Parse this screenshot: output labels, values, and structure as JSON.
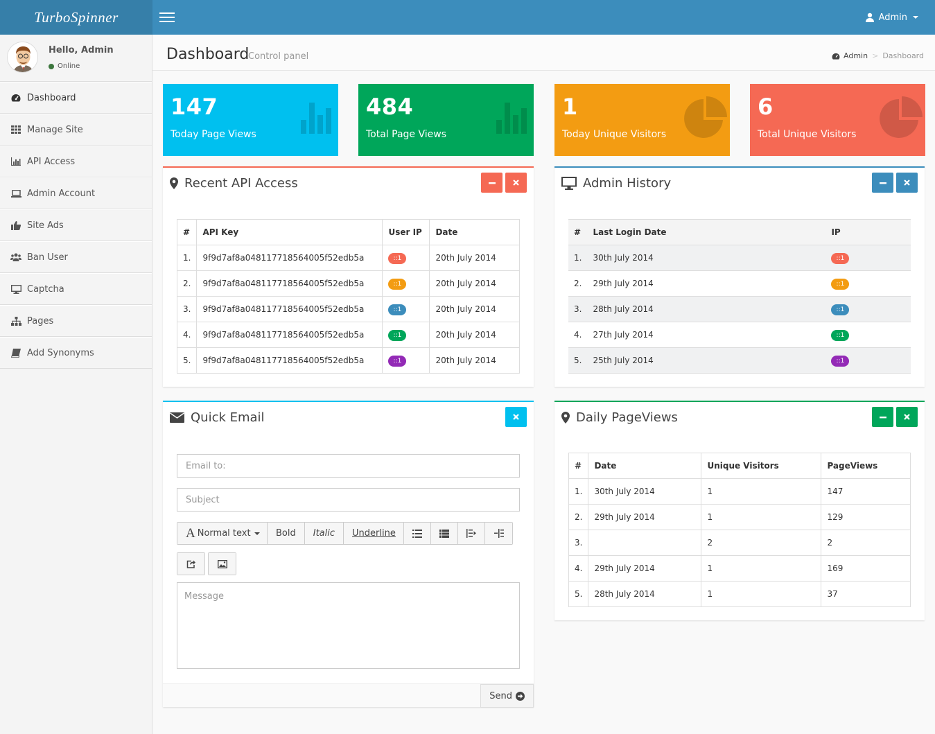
{
  "app": {
    "logo": "TurboSpinner"
  },
  "header": {
    "user_label": "Admin"
  },
  "sidebar": {
    "greeting": "Hello, Admin",
    "status": "Online",
    "items": [
      {
        "label": "Dashboard",
        "icon": "dashboard-icon"
      },
      {
        "label": "Manage Site",
        "icon": "grid-icon"
      },
      {
        "label": "API Access",
        "icon": "bar-chart-icon"
      },
      {
        "label": "Admin Account",
        "icon": "laptop-icon"
      },
      {
        "label": "Site Ads",
        "icon": "thumbs-up-icon"
      },
      {
        "label": "Ban User",
        "icon": "users-icon"
      },
      {
        "label": "Captcha",
        "icon": "desktop-icon"
      },
      {
        "label": "Pages",
        "icon": "sitemap-icon"
      },
      {
        "label": "Add Synonyms",
        "icon": "book-icon"
      }
    ]
  },
  "page": {
    "title": "Dashboard",
    "subtitle": "Control panel"
  },
  "breadcrumb": {
    "home": "Admin",
    "current": "Dashboard"
  },
  "stats": [
    {
      "value": "147",
      "label": "Today Page Views",
      "color": "#00c0ef",
      "icon": "bar-chart-icon"
    },
    {
      "value": "484",
      "label": "Total Page Views",
      "color": "#00a65a",
      "icon": "bar-chart-icon"
    },
    {
      "value": "1",
      "label": "Today Unique Visitors",
      "color": "#f39c12",
      "icon": "pie-chart-icon"
    },
    {
      "value": "6",
      "label": "Total Unique Visitors",
      "color": "#f56954",
      "icon": "pie-chart-icon"
    }
  ],
  "api_box": {
    "title": "Recent API Access",
    "headers": [
      "#",
      "API Key",
      "User IP",
      "Date"
    ],
    "rows": [
      {
        "n": "1.",
        "key": "9f9d7af8a048117718564005f52edb5a",
        "ip": "::1",
        "date": "20th July 2014"
      },
      {
        "n": "2.",
        "key": "9f9d7af8a048117718564005f52edb5a",
        "ip": "::1",
        "date": "20th July 2014"
      },
      {
        "n": "3.",
        "key": "9f9d7af8a048117718564005f52edb5a",
        "ip": "::1",
        "date": "20th July 2014"
      },
      {
        "n": "4.",
        "key": "9f9d7af8a048117718564005f52edb5a",
        "ip": "::1",
        "date": "20th July 2014"
      },
      {
        "n": "5.",
        "key": "9f9d7af8a048117718564005f52edb5a",
        "ip": "::1",
        "date": "20th July 2014"
      }
    ]
  },
  "history_box": {
    "title": "Admin History",
    "headers": [
      "#",
      "Last Login Date",
      "IP"
    ],
    "rows": [
      {
        "n": "1.",
        "date": "30th July 2014",
        "ip": "::1"
      },
      {
        "n": "2.",
        "date": "29th July 2014",
        "ip": "::1"
      },
      {
        "n": "3.",
        "date": "28th July 2014",
        "ip": "::1"
      },
      {
        "n": "4.",
        "date": "27th July 2014",
        "ip": "::1"
      },
      {
        "n": "5.",
        "date": "25th July 2014",
        "ip": "::1"
      }
    ]
  },
  "email_box": {
    "title": "Quick Email",
    "to_placeholder": "Email to:",
    "subject_placeholder": "Subject",
    "message_placeholder": "Message",
    "font_label": "Normal text",
    "bold": "Bold",
    "italic": "Italic",
    "underline": "Underline",
    "send": "Send"
  },
  "pageviews_box": {
    "title": "Daily PageViews",
    "headers": [
      "#",
      "Date",
      "Unique Visitors",
      "PageViews"
    ],
    "rows": [
      {
        "n": "1.",
        "date": "30th July 2014",
        "unique": "1",
        "views": "147"
      },
      {
        "n": "2.",
        "date": "29th July 2014",
        "unique": "1",
        "views": "129"
      },
      {
        "n": "3.",
        "date": "",
        "unique": "2",
        "views": "2"
      },
      {
        "n": "4.",
        "date": "29th July 2014",
        "unique": "1",
        "views": "169"
      },
      {
        "n": "5.",
        "date": "28th July 2014",
        "unique": "1",
        "views": "37"
      }
    ]
  },
  "colors": {
    "header": "#3c8dbc",
    "logo_bg": "#367fa9",
    "red": "#f56954",
    "yellow": "#f39c12",
    "blue": "#3c8dbc",
    "green": "#00a65a",
    "aqua": "#00c0ef",
    "purple": "#932ab6"
  }
}
